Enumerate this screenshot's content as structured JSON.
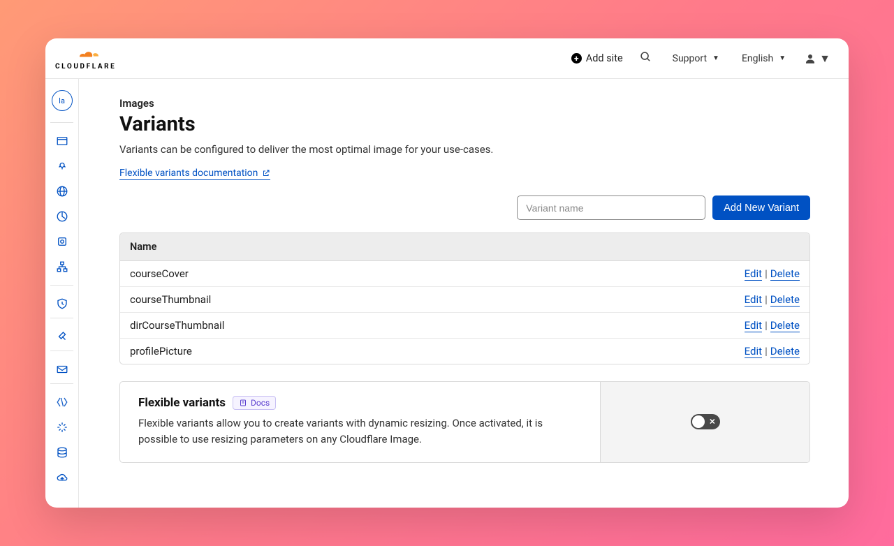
{
  "brand": {
    "name": "CLOUDFLARE"
  },
  "topbar": {
    "add_site": "Add site",
    "support": "Support",
    "language": "English"
  },
  "account": {
    "chip": "Ia"
  },
  "page": {
    "breadcrumb": "Images",
    "title": "Variants",
    "description": "Variants can be configured to deliver the most optimal image for your use-cases.",
    "doc_link": "Flexible variants documentation"
  },
  "actions": {
    "variant_placeholder": "Variant name",
    "add_button": "Add New Variant"
  },
  "table": {
    "header": "Name",
    "edit": "Edit",
    "delete": "Delete",
    "rows": [
      {
        "name": "courseCover"
      },
      {
        "name": "courseThumbnail"
      },
      {
        "name": "dirCourseThumbnail"
      },
      {
        "name": "profilePicture"
      }
    ]
  },
  "panel": {
    "title": "Flexible variants",
    "docs_label": "Docs",
    "description": "Flexible variants allow you to create variants with dynamic resizing. Once activated, it is possible to use resizing parameters on any Cloudflare Image.",
    "toggle_on": false
  },
  "colors": {
    "accent": "#0051c3",
    "brand_orange": "#f38020"
  }
}
